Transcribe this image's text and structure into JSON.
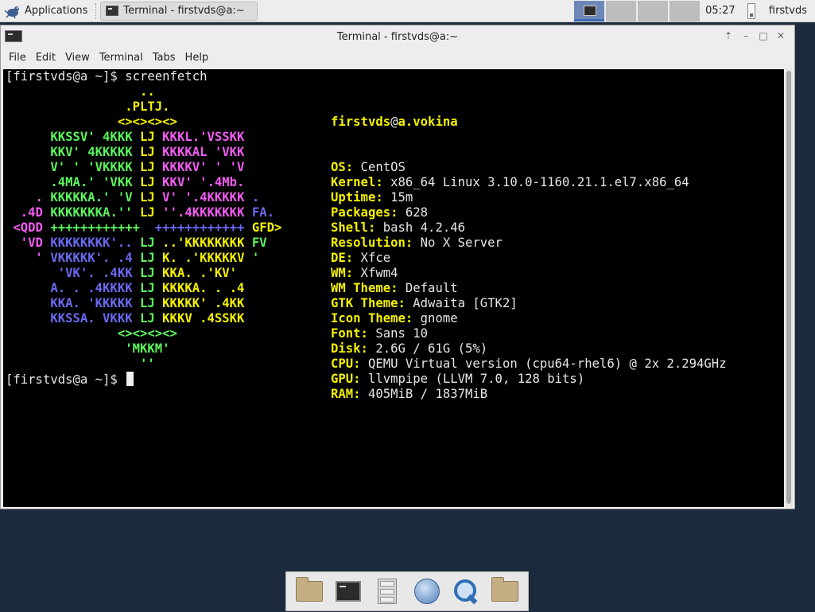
{
  "top_panel": {
    "applications_label": "Applications",
    "task_label": "Terminal - firstvds@a:~",
    "clock": "05:27",
    "user": "firstvds"
  },
  "window": {
    "title": "Terminal - firstvds@a:~",
    "menu": [
      "File",
      "Edit",
      "View",
      "Terminal",
      "Tabs",
      "Help"
    ]
  },
  "terminal": {
    "command_line": "[firstvds@a ~]$ screenfetch",
    "prompt": "[firstvds@a ~]$ ",
    "logo_lines": [
      [
        [
          "                  ..",
          "y"
        ]
      ],
      [
        [
          "                .PLTJ.",
          "y"
        ]
      ],
      [
        [
          "               <><><><>",
          "y"
        ]
      ],
      [
        [
          "      KKSSV' 4KKK ",
          "g"
        ],
        [
          "LJ",
          "y"
        ],
        [
          " KKKL.'VSSKK",
          "m"
        ]
      ],
      [
        [
          "      KKV' 4KKKKK ",
          "g"
        ],
        [
          "LJ",
          "y"
        ],
        [
          " KKKKAL 'VKK",
          "m"
        ]
      ],
      [
        [
          "      V' ' 'VKKKK ",
          "g"
        ],
        [
          "LJ",
          "y"
        ],
        [
          " KKKKV' ' 'V",
          "m"
        ]
      ],
      [
        [
          "      .4MA.' 'VKK ",
          "g"
        ],
        [
          "LJ",
          "y"
        ],
        [
          " KKV' '.4Mb.",
          "m"
        ]
      ],
      [
        [
          "    . ",
          "m"
        ],
        [
          "KKKKKA.' 'V ",
          "g"
        ],
        [
          "LJ",
          "y"
        ],
        [
          " V' '.4KKKKK ",
          "m"
        ],
        [
          ".",
          "b"
        ]
      ],
      [
        [
          "  .4D ",
          "m"
        ],
        [
          "KKKKKKKA.'' ",
          "g"
        ],
        [
          "LJ",
          "y"
        ],
        [
          " ''.4KKKKKKK ",
          "m"
        ],
        [
          "FA.",
          "b"
        ]
      ],
      [
        [
          " <QDD ",
          "m"
        ],
        [
          "++++++++++++  ",
          "g"
        ],
        [
          "++++++++++++ ",
          "b"
        ],
        [
          "GFD>",
          "y"
        ]
      ],
      [
        [
          "  'VD ",
          "m"
        ],
        [
          "KKKKKKKK'.. ",
          "b"
        ],
        [
          "LJ",
          "g"
        ],
        [
          " ..'KKKKKKKK ",
          "y"
        ],
        [
          "FV",
          "g"
        ]
      ],
      [
        [
          "    ' ",
          "m"
        ],
        [
          "VKKKKK'. .4 ",
          "b"
        ],
        [
          "LJ",
          "g"
        ],
        [
          " K. .'KKKKKV ",
          "y"
        ],
        [
          "'",
          "g"
        ]
      ],
      [
        [
          "       'VK'. .4KK ",
          "b"
        ],
        [
          "LJ",
          "g"
        ],
        [
          " KKA. .'KV'",
          "y"
        ]
      ],
      [
        [
          "      A. . .4KKKK ",
          "b"
        ],
        [
          "LJ",
          "g"
        ],
        [
          " KKKKA. . .4",
          "y"
        ]
      ],
      [
        [
          "      KKA. 'KKKKK ",
          "b"
        ],
        [
          "LJ",
          "g"
        ],
        [
          " KKKKK' .4KK",
          "y"
        ]
      ],
      [
        [
          "      KKSSA. VKKK ",
          "b"
        ],
        [
          "LJ",
          "g"
        ],
        [
          " KKKV .4SSKK",
          "y"
        ]
      ],
      [
        [
          "               <><><><>",
          "g"
        ]
      ],
      [
        [
          "                'MKKM'",
          "g"
        ]
      ],
      [
        [
          "                  ''",
          "g"
        ]
      ]
    ],
    "user_host": {
      "user": "firstvds",
      "at": "@",
      "host": "a.vokina"
    },
    "info": [
      {
        "key": "OS:",
        "value": "CentOS"
      },
      {
        "key": "Kernel:",
        "value": "x86_64 Linux 3.10.0-1160.21.1.el7.x86_64"
      },
      {
        "key": "Uptime:",
        "value": "15m"
      },
      {
        "key": "Packages:",
        "value": "628"
      },
      {
        "key": "Shell:",
        "value": "bash 4.2.46"
      },
      {
        "key": "Resolution:",
        "value": "No X Server"
      },
      {
        "key": "DE:",
        "value": "Xfce"
      },
      {
        "key": "WM:",
        "value": "Xfwm4"
      },
      {
        "key": "WM Theme:",
        "value": "Default"
      },
      {
        "key": "GTK Theme:",
        "value": "Adwaita [GTK2]"
      },
      {
        "key": "Icon Theme:",
        "value": "gnome"
      },
      {
        "key": "Font:",
        "value": "Sans 10"
      },
      {
        "key": "Disk:",
        "value": "2.6G / 61G (5%)"
      },
      {
        "key": "CPU:",
        "value": "QEMU Virtual version (cpu64-rhel6) @ 2x 2.294GHz"
      },
      {
        "key": "GPU:",
        "value": "llvmpipe (LLVM 7.0, 128 bits)"
      },
      {
        "key": "RAM:",
        "value": "405MiB / 1837MiB"
      }
    ]
  },
  "dock_icons": [
    "home-folder-icon",
    "terminal-icon",
    "file-manager-icon",
    "web-browser-icon",
    "app-finder-icon",
    "folder-icon"
  ],
  "colors": {
    "desktop": "#1b2a3c",
    "ansi_yellow": "#f3f000",
    "ansi_green": "#5cf55c",
    "ansi_magenta": "#f25cf2",
    "ansi_blue": "#6a6af0"
  }
}
